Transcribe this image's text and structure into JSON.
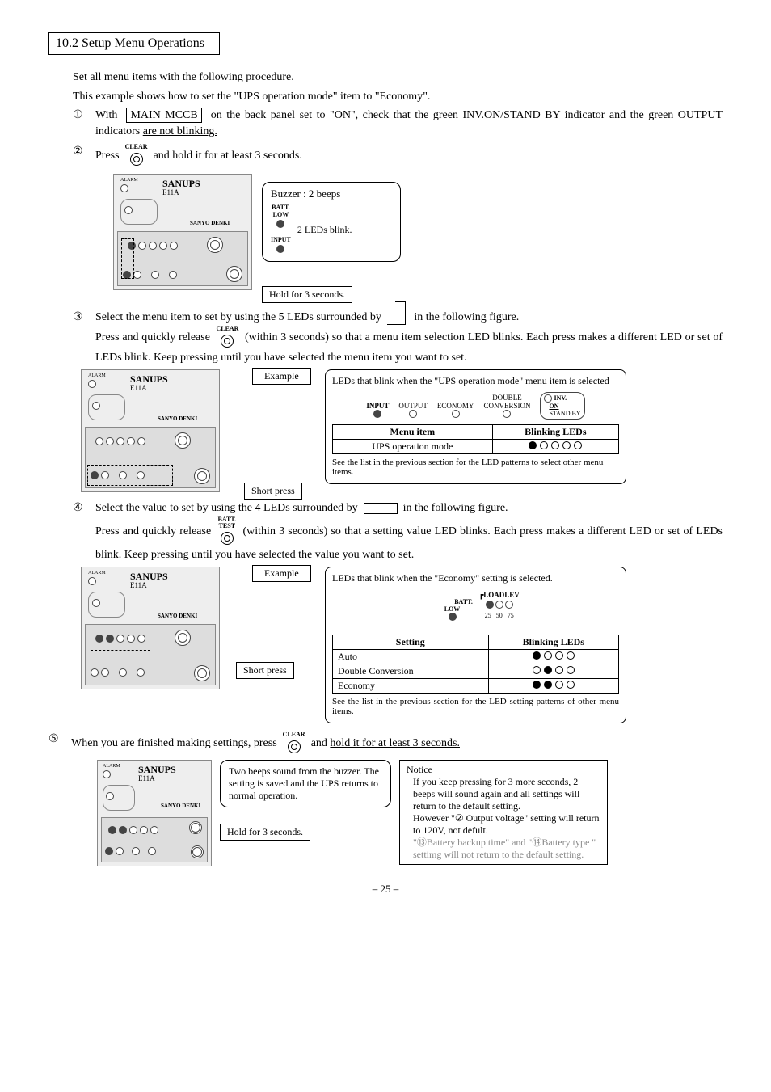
{
  "section_title": "10.2 Setup Menu Operations",
  "intro1": "Set all menu items with the following procedure.",
  "intro2": "This example shows how to set the \"UPS operation mode\" item to \"Economy\".",
  "step1_num": "①",
  "step1_a": "With",
  "step1_box": "MAIN MCCB",
  "step1_b": "on the back panel set to \"ON\", check that the green INV.ON/STAND BY indicator and the green OUTPUT indicators ",
  "step1_u": "are not blinking.",
  "step2_num": "②",
  "step2_a": "Press",
  "clear_label": "CLEAR",
  "step2_b": "and hold it for at least 3 seconds.",
  "buzzer": "Buzzer : 2 beeps",
  "batt_low": "BATT.\nLOW",
  "input_lbl": "INPUT",
  "two_leds": "2 LEDs blink.",
  "hold3": "Hold for 3 seconds.",
  "step3_num": "③",
  "step3_a": "Select the menu item to set by using the 5 LEDs surrounded by",
  "step3_b": "in the following figure.",
  "step3_c": "Press and quickly release",
  "step3_d": "(within 3 seconds) so that a menu item selection LED blinks. Each press makes a different LED or set of LEDs blink. Keep pressing until you have selected the menu item you want to set.",
  "example": "Example",
  "short_press": "Short press",
  "box3_title": "LEDs that blink when the \"UPS operation mode\" menu item is selected",
  "labels3": [
    "INPUT",
    "OUTPUT",
    "ECONOMY",
    "DOUBLE\nCONVERSION"
  ],
  "inv_lbl": "INV.",
  "on_lbl": "ON",
  "standby_lbl": "STAND BY",
  "th_menu": "Menu item",
  "th_blink": "Blinking LEDs",
  "row3_menu": "UPS operation mode",
  "foot3": "See the list in the previous section for the LED patterns to select other menu items.",
  "step4_num": "④",
  "step4_a": "Select the value to set by using the 4 LEDs surrounded by",
  "step4_b": "in the following figure.",
  "batt_test": "BATT.\nTEST",
  "step4_c": "Press and quickly release",
  "step4_d": "(within 3 seconds) so that a setting value LED blinks. Each press makes a different LED or set of LEDs blink. Keep pressing until you have selected the value you want to set.",
  "box4_title": "LEDs that blink when the \"Economy\" setting is selected.",
  "loadlev": "LOADLEV",
  "loadnums": [
    "25",
    "50",
    "75"
  ],
  "th_setting": "Setting",
  "row4a": "Auto",
  "row4b": "Double Conversion",
  "row4c": "Economy",
  "foot4": "See the list in the previous section for the LED setting patterns of other menu items.",
  "step5_num": "⑤",
  "step5_a": "When you are finished making settings, press",
  "step5_b": "and ",
  "step5_u": "hold it for at least 3 seconds.",
  "box5a": "Two beeps sound from the buzzer. The setting is saved and the UPS returns to normal operation.",
  "notice_hdr": "Notice",
  "notice1": "If you keep pressing for 3 more seconds, 2 beeps will sound again and all settings will return to the default setting.",
  "notice2": "However \"② Output voltage\" setting will return to 120V, not defult.",
  "notice3": "\"⑬Battery backup time\" and \"⑭Battery type \" settimg will not return to the default setting.",
  "brand": "SANUPS",
  "model": "E11A",
  "logo2": "SANYO DENKI",
  "alarm": "ALARM",
  "page": "– 25 –"
}
